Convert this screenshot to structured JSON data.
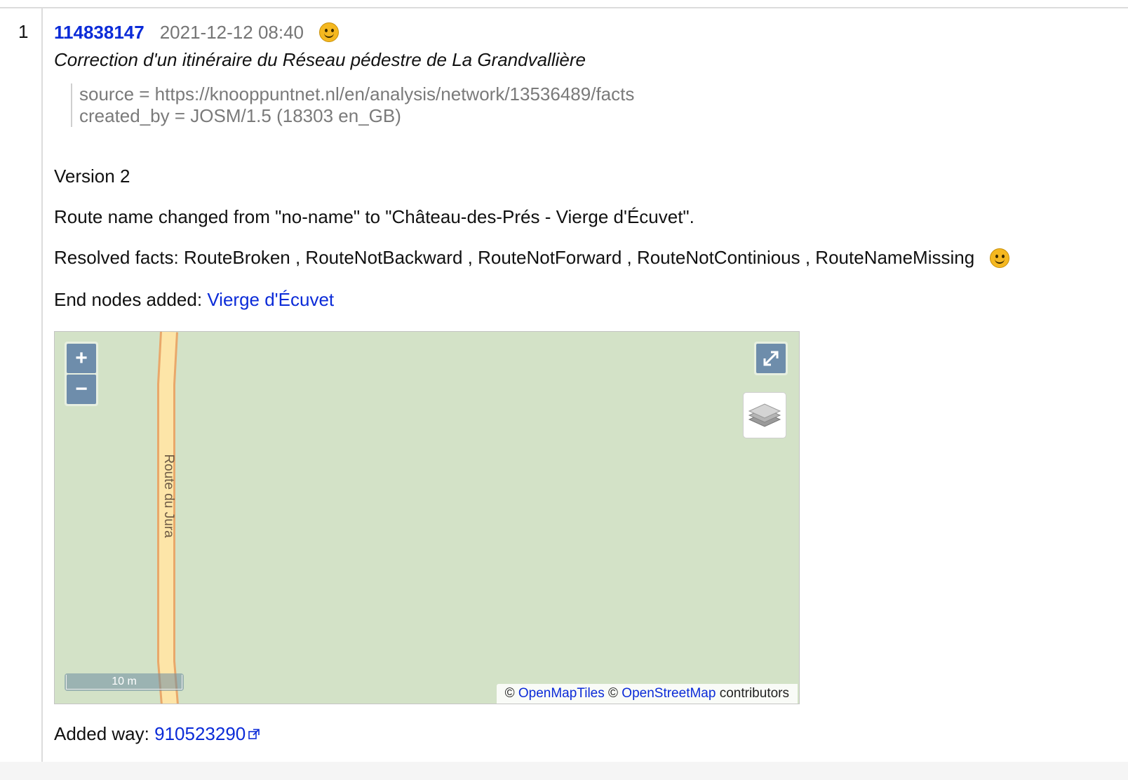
{
  "row": {
    "number": "1",
    "changeset_id": "114838147",
    "timestamp": "2021-12-12 08:40",
    "comment": "Correction d'un itinéraire du Réseau pédestre de La Grandvallière",
    "tags": [
      "source = https://knooppuntnet.nl/en/analysis/network/13536489/facts",
      "created_by = JOSM/1.5 (18303 en_GB)"
    ]
  },
  "details": {
    "version": "Version 2",
    "route_name_change": "Route name changed from \"no-name\" to \"Château-des-Prés - Vierge d'Écuvet\".",
    "resolved_facts_label": "Resolved facts:",
    "resolved_facts": "RouteBroken , RouteNotBackward , RouteNotForward , RouteNotContinious , RouteNameMissing",
    "end_nodes_label": "End nodes added:",
    "end_node": "Vierge d'Écuvet",
    "added_way_label": "Added way:",
    "added_way_id": "910523290"
  },
  "map": {
    "road_label": "Route du Jura",
    "zoom_in": "+",
    "zoom_out": "−",
    "scale_label": "10 m",
    "attribution_copy1": "©",
    "attribution_link1": "OpenMapTiles",
    "attribution_copy2": "©",
    "attribution_link2": "OpenStreetMap",
    "attribution_suffix": "contributors",
    "land_color": "#d3e2c7",
    "road_color": "#fde5a8",
    "control_color": "#6e8dab"
  },
  "colors": {
    "link": "#0b2bd8",
    "muted": "#757575",
    "happy": "#f5b820"
  },
  "icons": [
    "happy-smiley-icon",
    "fullscreen-icon",
    "layers-icon",
    "external-link-icon"
  ]
}
